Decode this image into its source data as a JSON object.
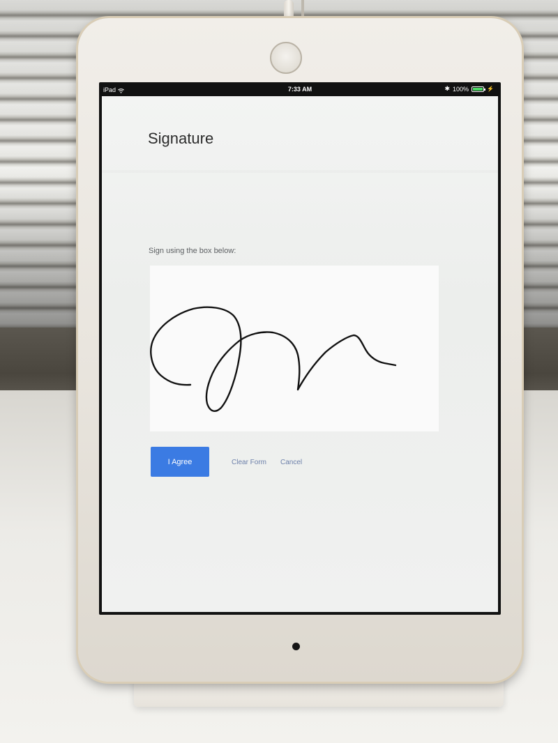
{
  "status_bar": {
    "device": "iPad",
    "time": "7:33 AM",
    "battery": "100%",
    "battery_level": 1.0
  },
  "page": {
    "title": "Signature",
    "instruction": "Sign using the box below:"
  },
  "actions": {
    "agree_label": "I Agree",
    "clear_label": "Clear Form",
    "cancel_label": "Cancel"
  },
  "colors": {
    "primary_button": "#3b7be3",
    "link": "#6b7fa9",
    "battery": "#4cd964"
  }
}
